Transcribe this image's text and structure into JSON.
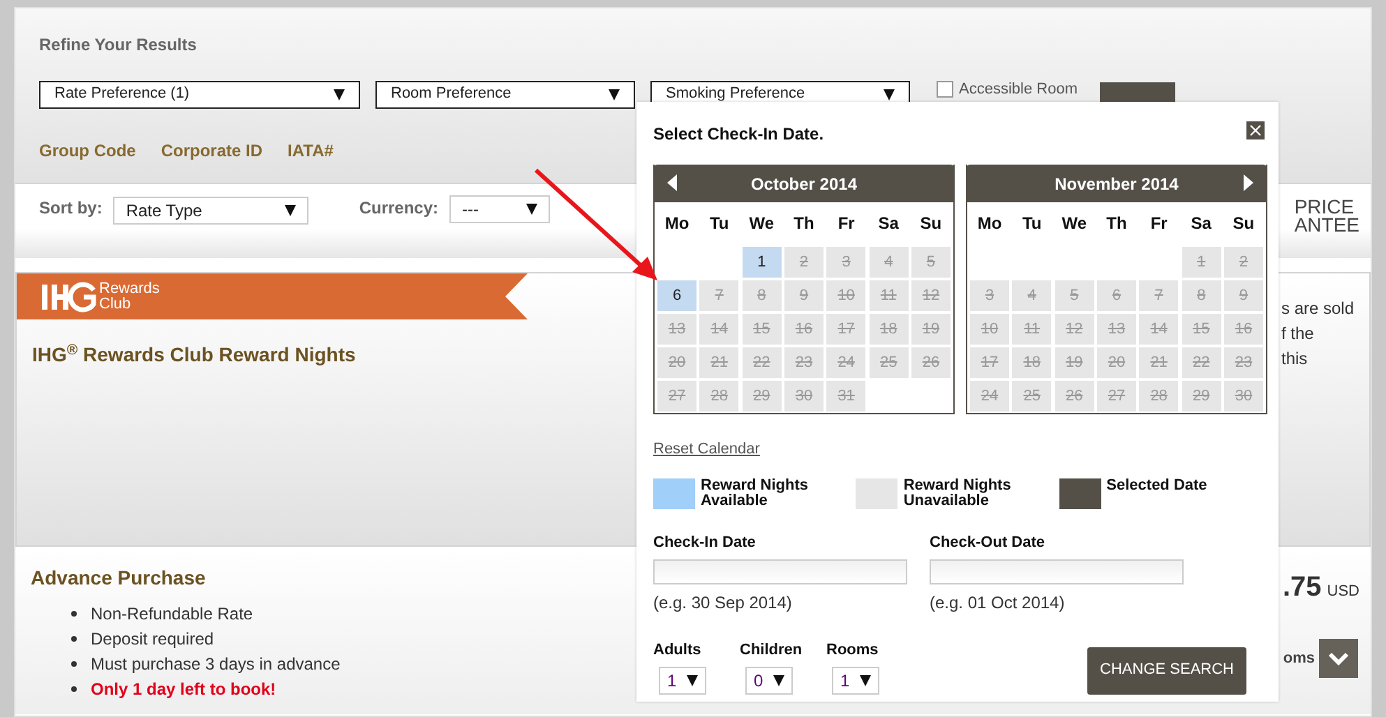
{
  "refine": {
    "title": "Refine Your Results",
    "dropdowns": [
      "Rate Preference (1)",
      "Room Preference",
      "Smoking Preference"
    ],
    "accessible_room": {
      "label": "Accessible Room",
      "checked": false
    },
    "links": [
      "Group Code",
      "Corporate ID",
      "IATA#"
    ]
  },
  "sort": {
    "label": "Sort by:",
    "value": "Rate Type",
    "currency_label": "Currency:",
    "currency_value": "---"
  },
  "guarantee_text": [
    "PRICE",
    "ANTEE"
  ],
  "reward_card": {
    "title": "IHG$^{®}$ Rewards Club Reward Nights",
    "logo_text": [
      "Rewards",
      "Club"
    ],
    "side_text": [
      "s are sold",
      "f the",
      "this"
    ]
  },
  "advance": {
    "title": "Advance Purchase",
    "bullets": [
      {
        "text": "Non-Refundable Rate",
        "kind": "normal"
      },
      {
        "text": "Deposit required",
        "kind": "normal"
      },
      {
        "text": "Must purchase 3 days in advance",
        "kind": "normal"
      },
      {
        "text": "Only 1 day left to book!",
        "kind": "alert"
      }
    ],
    "price": ".75",
    "currency": "USD",
    "rooms_link": "oms"
  },
  "calendar_popup": {
    "title": "Select Check-In Date.",
    "months": [
      {
        "name": "October 2014",
        "prev_button": true,
        "next_button": false,
        "weekdays": [
          "Mo",
          "Tu",
          "We",
          "Th",
          "Fr",
          "Sa",
          "Su"
        ],
        "weeks": [
          [
            {
              "kind": "blank"
            },
            {
              "kind": "blank"
            },
            {
              "d": "1",
              "available": true
            },
            {
              "d": "2",
              "available": false
            },
            {
              "d": "3",
              "available": false
            },
            {
              "d": "4",
              "available": false
            },
            {
              "d": "5",
              "available": false
            }
          ],
          [
            {
              "d": "6",
              "available": true
            },
            {
              "d": "7",
              "available": false
            },
            {
              "d": "8",
              "available": false
            },
            {
              "d": "9",
              "available": false
            },
            {
              "d": "10",
              "available": false
            },
            {
              "d": "11",
              "available": false
            },
            {
              "d": "12",
              "available": false
            }
          ],
          [
            {
              "d": "13",
              "available": false
            },
            {
              "d": "14",
              "available": false
            },
            {
              "d": "15",
              "available": false
            },
            {
              "d": "16",
              "available": false
            },
            {
              "d": "17",
              "available": false
            },
            {
              "d": "18",
              "available": false
            },
            {
              "d": "19",
              "available": false
            }
          ],
          [
            {
              "d": "20",
              "available": false
            },
            {
              "d": "21",
              "available": false
            },
            {
              "d": "22",
              "available": false
            },
            {
              "d": "23",
              "available": false
            },
            {
              "d": "24",
              "available": false
            },
            {
              "d": "25",
              "available": false
            },
            {
              "d": "26",
              "available": false
            }
          ],
          [
            {
              "d": "27",
              "available": false
            },
            {
              "d": "28",
              "available": false
            },
            {
              "d": "29",
              "available": false
            },
            {
              "d": "30",
              "available": false
            },
            {
              "d": "31",
              "available": false
            },
            {
              "kind": "blank"
            },
            {
              "kind": "blank"
            }
          ]
        ]
      },
      {
        "name": "November 2014",
        "prev_button": false,
        "next_button": true,
        "weekdays": [
          "Mo",
          "Tu",
          "We",
          "Th",
          "Fr",
          "Sa",
          "Su"
        ],
        "weeks": [
          [
            {
              "kind": "blank"
            },
            {
              "kind": "blank"
            },
            {
              "kind": "blank"
            },
            {
              "kind": "blank"
            },
            {
              "kind": "blank"
            },
            {
              "d": "1",
              "available": false
            },
            {
              "d": "2",
              "available": false
            }
          ],
          [
            {
              "d": "3",
              "available": false
            },
            {
              "d": "4",
              "available": false
            },
            {
              "d": "5",
              "available": false
            },
            {
              "d": "6",
              "available": false
            },
            {
              "d": "7",
              "available": false
            },
            {
              "d": "8",
              "available": false
            },
            {
              "d": "9",
              "available": false
            }
          ],
          [
            {
              "d": "10",
              "available": false
            },
            {
              "d": "11",
              "available": false
            },
            {
              "d": "12",
              "available": false
            },
            {
              "d": "13",
              "available": false
            },
            {
              "d": "14",
              "available": false
            },
            {
              "d": "15",
              "available": false
            },
            {
              "d": "16",
              "available": false
            }
          ],
          [
            {
              "d": "17",
              "available": false
            },
            {
              "d": "18",
              "available": false
            },
            {
              "d": "19",
              "available": false
            },
            {
              "d": "20",
              "available": false
            },
            {
              "d": "21",
              "available": false
            },
            {
              "d": "22",
              "available": false
            },
            {
              "d": "23",
              "available": false
            }
          ],
          [
            {
              "d": "24",
              "available": false
            },
            {
              "d": "25",
              "available": false
            },
            {
              "d": "26",
              "available": false
            },
            {
              "d": "27",
              "available": false
            },
            {
              "d": "28",
              "available": false
            },
            {
              "d": "29",
              "available": false
            },
            {
              "d": "30",
              "available": false
            }
          ]
        ]
      }
    ],
    "reset_link": "Reset Calendar",
    "legend": [
      {
        "kind": "available",
        "label": "Reward Nights Available"
      },
      {
        "kind": "unavailable",
        "label": "Reward Nights Unavailable"
      },
      {
        "kind": "selected",
        "label": "Selected Date"
      }
    ],
    "dates": [
      {
        "label": "Check-In Date",
        "hint": "(e.g. 30 Sep 2014)"
      },
      {
        "label": "Check-Out Date",
        "hint": "(e.g. 01 Oct 2014)"
      }
    ],
    "selects": [
      {
        "label": "Adults",
        "value": "1"
      },
      {
        "label": "Children",
        "value": "0"
      },
      {
        "label": "Rooms",
        "value": "1"
      }
    ],
    "button": "CHANGE SEARCH"
  }
}
